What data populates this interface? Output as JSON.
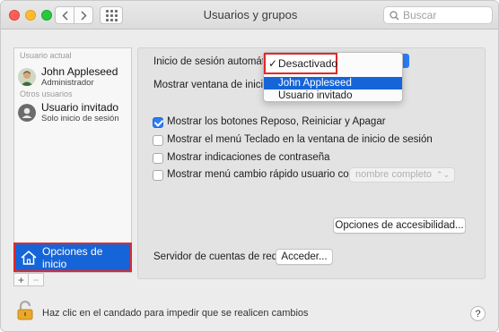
{
  "window": {
    "title": "Usuarios y grupos",
    "search_placeholder": "Buscar"
  },
  "sidebar": {
    "current_user_label": "Usuario actual",
    "current_user": {
      "name": "John Appleseed",
      "role": "Administrador"
    },
    "other_users_label": "Otros usuarios",
    "guest_user": {
      "name": "Usuario invitado",
      "role": "Solo inicio de sesión"
    },
    "login_options_label": "Opciones de inicio",
    "add_label": "+",
    "remove_label": "−"
  },
  "main": {
    "auto_login_label": "Inicio de sesión automático:",
    "show_window_label": "Mostrar ventana de inicio de sesión como:",
    "dropdown": {
      "selected": "Desactivado",
      "options": [
        "John Appleseed",
        "Usuario invitado"
      ]
    },
    "checkboxes": [
      {
        "label": "Mostrar los botones Reposo, Reiniciar y Apagar",
        "checked": true
      },
      {
        "label": "Mostrar el menú Teclado en la ventana de inicio de sesión",
        "checked": false
      },
      {
        "label": "Mostrar indicaciones de contraseña",
        "checked": false
      },
      {
        "label": "Mostrar menú cambio rápido usuario como",
        "checked": false
      }
    ],
    "fast_switch_value": "nombre completo",
    "accessibility_button": "Opciones de accesibilidad...",
    "network_server_label": "Servidor de cuentas de red:",
    "join_button": "Acceder..."
  },
  "footer": {
    "lock_text": "Haz clic en el candado para impedir que se realicen cambios",
    "help_label": "?"
  },
  "colors": {
    "accent": "#1565d8",
    "highlight_box": "#e02a2a"
  }
}
